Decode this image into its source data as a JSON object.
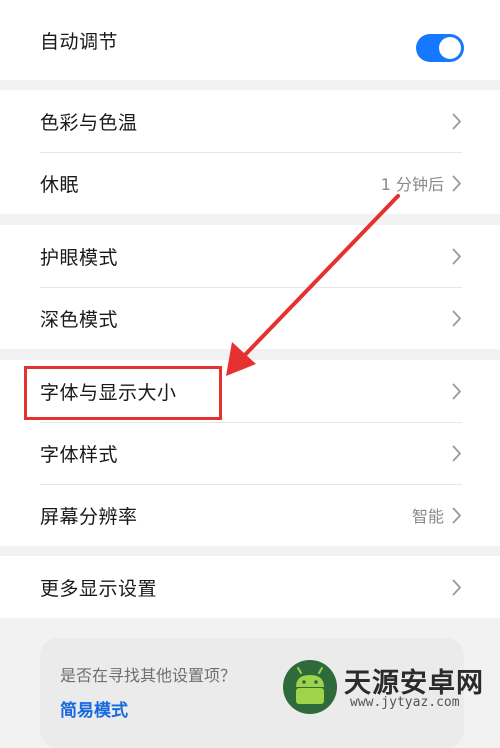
{
  "settings": {
    "auto_adjust": {
      "label": "自动调节",
      "enabled": true
    },
    "groups": [
      {
        "items": [
          {
            "label": "色彩与色温",
            "value": ""
          },
          {
            "label": "休眠",
            "value": "1 分钟后"
          }
        ]
      },
      {
        "items": [
          {
            "label": "护眼模式",
            "value": ""
          },
          {
            "label": "深色模式",
            "value": ""
          }
        ]
      },
      {
        "items": [
          {
            "label": "字体与显示大小",
            "value": ""
          },
          {
            "label": "字体样式",
            "value": ""
          },
          {
            "label": "屏幕分辨率",
            "value": "智能"
          }
        ]
      },
      {
        "items": [
          {
            "label": "更多显示设置",
            "value": ""
          }
        ]
      }
    ]
  },
  "suggestion_card": {
    "question": "是否在寻找其他设置项？",
    "link": "简易模式"
  },
  "watermark": {
    "title": "天源安卓网",
    "url": "www.jytyaz.com"
  },
  "colors": {
    "accent": "#1677ff",
    "annotation_red": "#e5312f",
    "link_blue": "#1769e0",
    "background": "#f2f2f2"
  },
  "icons": {
    "chevron": "chevron-right-icon",
    "watermark_logo": "android-robot-icon"
  }
}
